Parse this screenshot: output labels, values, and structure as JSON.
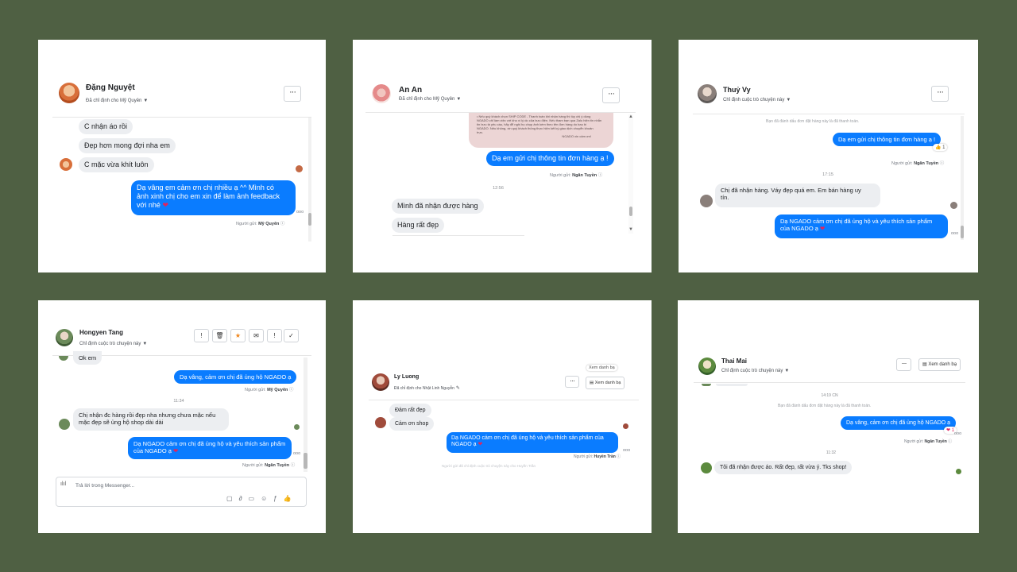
{
  "colors": {
    "background": "#4f6043",
    "outgoing": "#0a7cff",
    "incoming": "#eceef1"
  },
  "icons": {
    "more": "more-dots-icon",
    "heart": "heart-icon",
    "eye": "seen-icon",
    "like": "thumbs-up-icon"
  },
  "chat1": {
    "name": "Đặng Nguyệt",
    "assigned": "Đã chỉ định cho Mỹ Quyên",
    "more": "···",
    "messages": [
      "C nhận áo rồi",
      "Đẹp hơn mong đợi nha em",
      "C mặc vừa khít luôn"
    ],
    "reply_line1": "Dạ vâng em cảm ơn chị nhiều ạ ^^ Mình có",
    "reply_line2": "ảnh xinh chị cho em xin để làm ảnh feedback",
    "reply_line3": "với nhé",
    "heart": "❤",
    "sender_label": "Người gửi:",
    "sender": "Mỹ Quyên"
  },
  "chat2": {
    "name": "An An",
    "assigned": "Đã chỉ định cho Mỹ Quyên",
    "more": "···",
    "quoted_line1": "• Nếu quý khách chọn SHIP CODE - Thanh toán khi nhận hàng thì tùy chị ý dùng",
    "quoted_line2": "NGADO chỉ làm việc với kho vì lý do của bưu điện. Nếu tham bạn qua Zalo hiện tin nhắn",
    "quoted_line3": "tin bưu tá yêu cầu, hãy để nghị họ chụp ảnh kèm theo tên đơn hàng do bao bì",
    "quoted_line4": "NGADO. Nếu không, xin quý khách thông thực hiện kết ký giao dịch chuyển khoản",
    "quoted_line5": "trực.",
    "quoted_sign": "NGADO xin cảm ơn!",
    "reply": "Dạ em gửi chị thông tin đơn hàng ạ !",
    "sender_label": "Người gửi:",
    "sender": "Ngân Tuyền",
    "time": "12:56",
    "messages": [
      "Mình đã nhận được hàng",
      "Hàng rất đẹp"
    ]
  },
  "chat3": {
    "name": "Thuỷ Vy",
    "assigned": "Chỉ định cuộc trò chuyện này",
    "more": "···",
    "system": "Bạn đã đánh dấu đơn đặt hàng này là đã thanh toán.",
    "reply1": "Dạ em gửi chị thông tin đơn hàng ạ !",
    "reaction": "👍 1",
    "sender_label": "Người gửi:",
    "sender": "Ngân Tuyền",
    "time": "17:15",
    "msg_line1": "Chị đã nhận hàng. Váy đẹp quá em. Em bán hàng uy",
    "msg_line2": "tín.",
    "reply2_line1": "Dạ NGADO cảm ơn chị đã ủng hộ và yêu thích sản phẩm",
    "reply2_line2": "của NGADO ạ",
    "heart": "❤"
  },
  "chat4": {
    "name": "Hongyen Tang",
    "assigned": "Chỉ định cuộc trò chuyện này",
    "toolbar": [
      "!",
      "🗑",
      "★",
      "✉",
      "!",
      "✓"
    ],
    "first": "Ok em",
    "reply1": "Dạ vâng, cảm ơn chị đã ủng hộ NGADO ạ",
    "sender_label1": "Người gửi:",
    "sender1": "Mỹ Quyên",
    "time": "11:34",
    "msg_line1": "Chị nhận đc hàng rồi đẹp nha nhưng chưa mặc nếu",
    "msg_line2": "mặc đẹp sẽ ủng hộ shop dài dài",
    "reply2_line1": "Dạ NGADO cảm ơn chị đã ủng hộ và yêu thích sản phẩm",
    "reply2_line2": "của NGADO ạ",
    "heart": "❤",
    "sender_label2": "Người gửi:",
    "sender2": "Ngân Tuyền",
    "composer_placeholder": "Trả lời trong Messenger..."
  },
  "chat5": {
    "name": "Ly Luong",
    "assigned": "Đã chỉ định cho Nhật Linh Nguyễn",
    "more": "···",
    "tooltip": "Xem danh bạ",
    "contacts_button": "Xem danh bạ",
    "messages": [
      "Đảm rất đẹp",
      "Cảm ơn shop"
    ],
    "reply_line1": "Dạ NGADO cảm ơn chị đã ủng hộ và yêu thích sản phẩm của",
    "reply_line2": "NGADO ạ",
    "heart": "❤",
    "sender_label": "Người gửi:",
    "sender": "Huyền Trần",
    "system": "Người gửi đã chỉ định cuộc trò chuyện này cho Huyền Trần"
  },
  "chat6": {
    "name": "Thai Mai",
    "assigned": "Chỉ định cuộc trò chuyện này",
    "more": "···",
    "contacts_button": "Xem danh bạ",
    "time1": "14:19 CN",
    "system": "Bạn đã đánh dấu đơn đặt hàng này là đã thanh toán.",
    "reply": "Dạ vâng, cảm ơn chị đã ủng hộ NGADO ạ",
    "reaction": "❤ 1",
    "sender_label": "Người gửi:",
    "sender": "Ngân Tuyền",
    "time2": "11:32",
    "message": "Tôi đã nhận được áo. Rất đẹp, rất vừa ý. Tks shop!"
  }
}
